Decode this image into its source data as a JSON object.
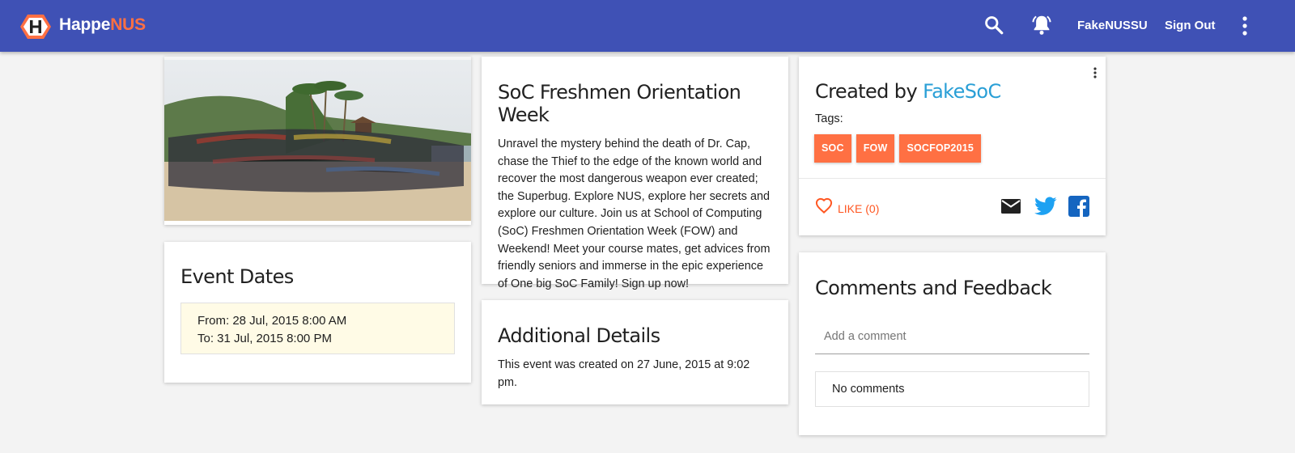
{
  "header": {
    "brand_part1": "Happe",
    "brand_part2": "NUS",
    "user_name": "FakeNUSSU",
    "signout_label": "Sign Out",
    "accent_color": "#ff7043",
    "bar_color": "#3f51b5",
    "icons": [
      "search-icon",
      "notification-bell-icon",
      "more-vert-icon"
    ]
  },
  "event": {
    "title": "SoC Freshmen Orientation Week",
    "description": "Unravel the mystery behind the death of Dr. Cap, chase the Thief to the edge of the known world and recover the most dangerous weapon ever created; the Superbug. Explore NUS, explore her secrets and explore our culture. Join us at School of Computing (SoC) Freshmen Orientation Week (FOW) and Weekend! Meet your course mates, get advices from friendly seniors and immerse in the epic experience of One big SoC Family! Sign up now!"
  },
  "dates": {
    "title": "Event Dates",
    "from": "From: 28 Jul, 2015 8:00 AM",
    "to": "To: 31 Jul, 2015 8:00 PM"
  },
  "details": {
    "title": "Additional Details",
    "text": "This event was created on 27 June, 2015 at 9:02 pm."
  },
  "creator": {
    "prefix": "Created by ",
    "author": "FakeSoC",
    "tags_label": "Tags:",
    "tags": [
      "SOC",
      "FOW",
      "SOCFOP2015"
    ],
    "like_label": "LIKE (0)",
    "share_icons": [
      "email-icon",
      "twitter-icon",
      "facebook-icon"
    ]
  },
  "comments": {
    "title": "Comments and Feedback",
    "placeholder": "Add a comment",
    "empty_text": "No comments"
  }
}
